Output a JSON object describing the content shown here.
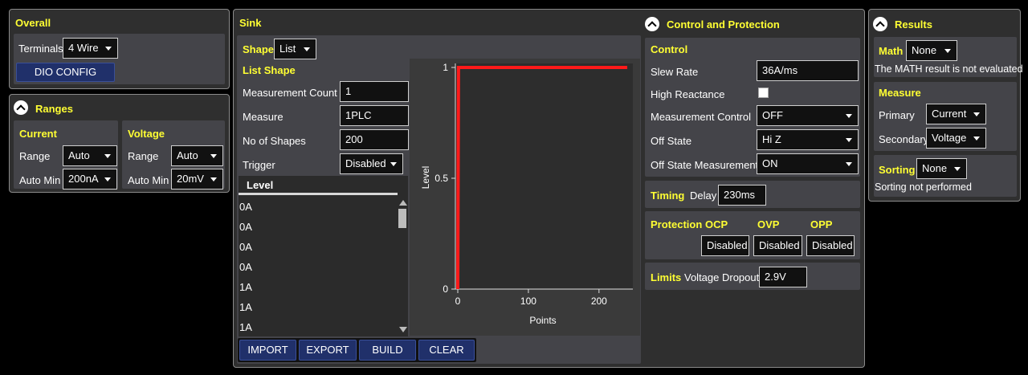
{
  "overall": {
    "title": "Overall",
    "terminals_label": "Terminals",
    "terminals_value": "4 Wire",
    "dio_button": "DIO CONFIG"
  },
  "ranges": {
    "title": "Ranges",
    "current": {
      "title": "Current",
      "range_label": "Range",
      "range_value": "Auto",
      "automin_label": "Auto Min",
      "automin_value": "200nA"
    },
    "voltage": {
      "title": "Voltage",
      "range_label": "Range",
      "range_value": "Auto",
      "automin_label": "Auto Min",
      "automin_value": "20mV"
    }
  },
  "sink": {
    "title": "Sink",
    "shape_label": "Shape",
    "shape_value": "List",
    "list_shape_title": "List Shape",
    "fields": [
      {
        "label": "Measurement Count",
        "value": "1"
      },
      {
        "label": "Measure",
        "value": "1PLC"
      },
      {
        "label": "No of Shapes",
        "value": "200"
      },
      {
        "label": "Trigger",
        "value": "Disabled"
      }
    ],
    "list_header": "Level",
    "list_values": [
      "0A",
      "0A",
      "0A",
      "0A",
      "1A",
      "1A",
      "1A"
    ],
    "buttons": {
      "import": "IMPORT",
      "export": "EXPORT",
      "build": "BUILD",
      "clear": "CLEAR"
    }
  },
  "chart_data": {
    "type": "line",
    "x": [
      0,
      1,
      2,
      240
    ],
    "series": [
      {
        "values": [
          0,
          1,
          1,
          1
        ],
        "color": "#ff1a1a"
      }
    ],
    "xlabel": "Points",
    "ylabel": "Level",
    "xlim": [
      0,
      240
    ],
    "ylim": [
      0,
      1
    ],
    "xticks": [
      "0",
      "100",
      "200"
    ],
    "yticks": [
      "0",
      "0.5",
      "1"
    ],
    "grid": false
  },
  "control_protection": {
    "title": "Control and Protection",
    "control": {
      "title": "Control",
      "slew_label": "Slew Rate",
      "slew_value": "36A/ms",
      "high_reactance_label": "High Reactance",
      "mc_label": "Measurement Control",
      "mc_value": "OFF",
      "off_state_label": "Off State",
      "off_state_value": "Hi Z",
      "osm_label": "Off State Measurements",
      "osm_value": "ON"
    },
    "timing": {
      "title": "Timing",
      "delay_label": "Delay",
      "delay_value": "230ms"
    },
    "protection": {
      "title": "Protection",
      "ocp_label": "OCP",
      "ocp_value": "Disabled",
      "ovp_label": "OVP",
      "ovp_value": "Disabled",
      "opp_label": "OPP",
      "opp_value": "Disabled"
    },
    "limits": {
      "title": "Limits",
      "dropout_label": "Voltage Dropout",
      "dropout_value": "2.9V"
    }
  },
  "results": {
    "title": "Results",
    "math_label": "Math",
    "math_value": "None",
    "math_note": "The MATH result is not evaluated",
    "measure_title": "Measure",
    "primary_label": "Primary",
    "primary_value": "Current",
    "secondary_label": "Secondary",
    "secondary_value": "Voltage",
    "sorting_label": "Sorting",
    "sorting_value": "None",
    "sorting_note": "Sorting not performed"
  }
}
